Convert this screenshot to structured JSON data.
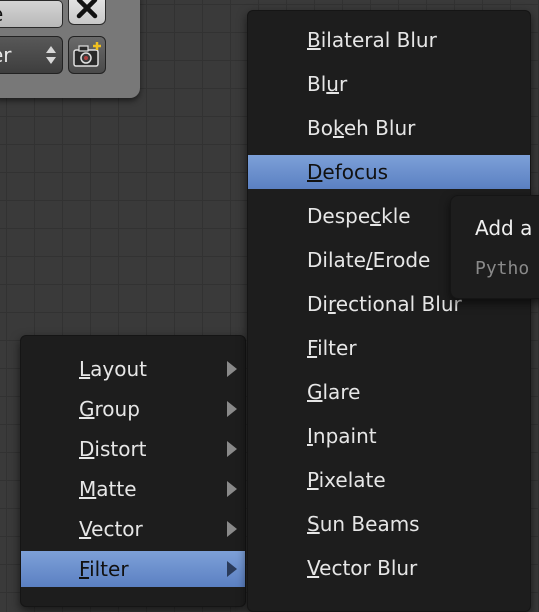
{
  "node_panel": {
    "name_field_value": "e",
    "scene_select_value": "er",
    "close_icon": "close-x-icon",
    "camera_icon": "camera-add-icon"
  },
  "add_menu": {
    "categories": [
      {
        "label": "Layout",
        "underline_index": 0
      },
      {
        "label": "Group",
        "underline_index": 0
      },
      {
        "label": "Distort",
        "underline_index": 0
      },
      {
        "label": "Matte",
        "underline_index": 0
      },
      {
        "label": "Vector",
        "underline_index": 0
      },
      {
        "label": "Filter",
        "underline_index": 0,
        "active": true
      }
    ]
  },
  "filter_menu": {
    "items": [
      {
        "label": "Bilateral Blur",
        "underline_index": 0
      },
      {
        "label": "Blur",
        "underline_index": 2
      },
      {
        "label": "Bokeh Blur",
        "underline_index": 2
      },
      {
        "label": "Defocus",
        "underline_index": 0,
        "active": true
      },
      {
        "label": "Despeckle",
        "underline_index": 5
      },
      {
        "label": "Dilate/Erode",
        "underline_index": 6
      },
      {
        "label": "Directional Blur",
        "underline_index": 2
      },
      {
        "label": "Filter",
        "underline_index": 0
      },
      {
        "label": "Glare",
        "underline_index": 0
      },
      {
        "label": "Inpaint",
        "underline_index": 0
      },
      {
        "label": "Pixelate",
        "underline_index": 0
      },
      {
        "label": "Sun Beams",
        "underline_index": 0
      },
      {
        "label": "Vector Blur",
        "underline_index": 0
      }
    ]
  },
  "tooltip": {
    "title": "Add a",
    "python": "Pytho"
  },
  "colors": {
    "highlight": "#6a8fd0",
    "menu_bg": "#1d1d1d",
    "canvas_bg": "#3a3a3a"
  }
}
